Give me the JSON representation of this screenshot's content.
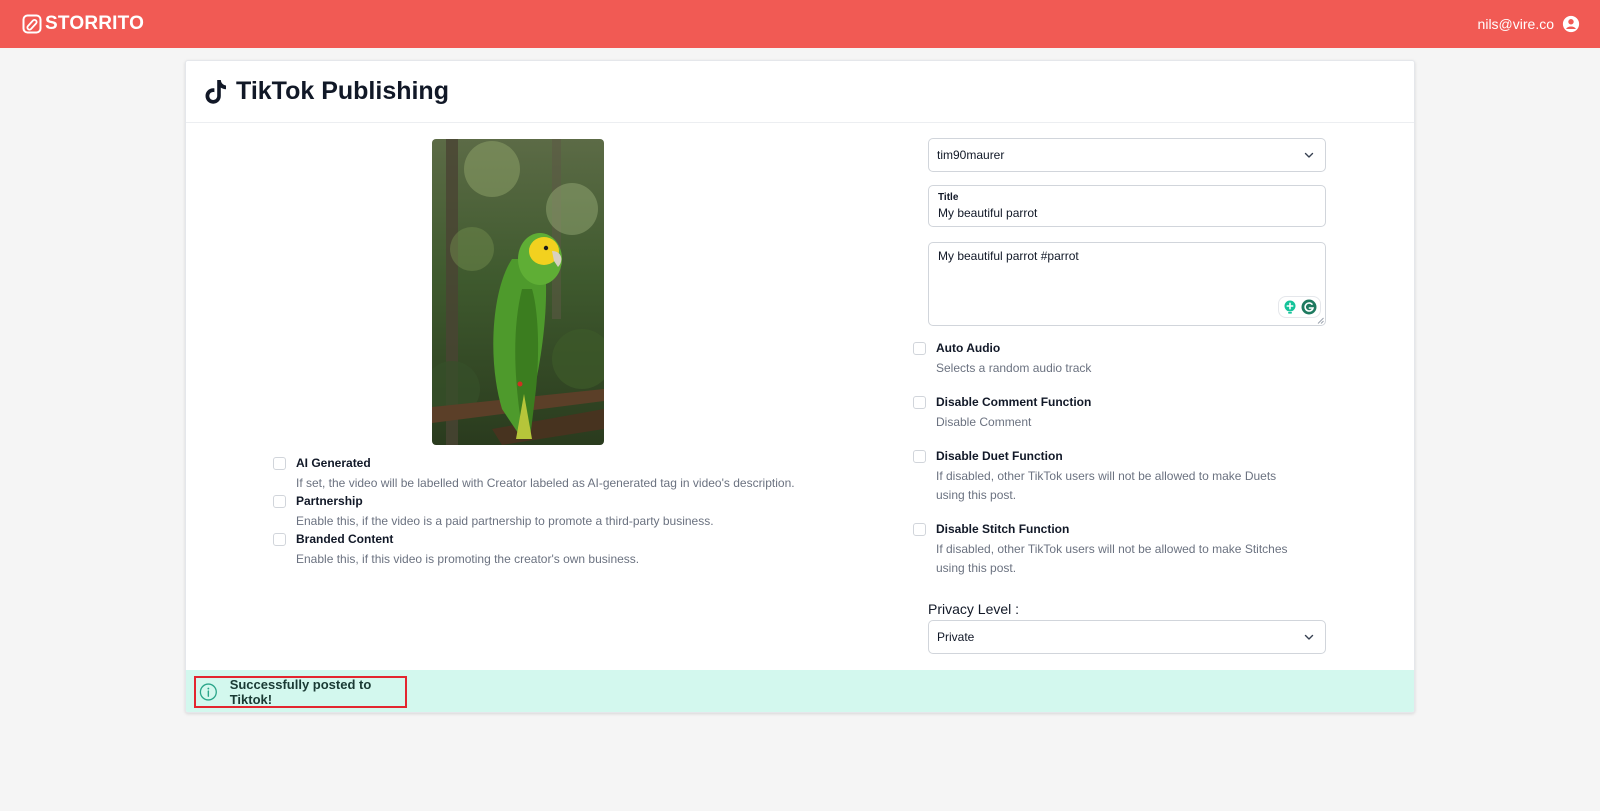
{
  "app": {
    "brand_name": "STORRITO",
    "user_email": "nils@vire.co"
  },
  "page": {
    "title": "TikTok Publishing"
  },
  "left_options": [
    {
      "title": "AI Generated",
      "description": "If set, the video will be labelled with Creator labeled as AI-generated tag in video's description.",
      "checked": false
    },
    {
      "title": "Partnership",
      "description": "Enable this, if the video is a paid partnership to promote a third-party business.",
      "checked": false
    },
    {
      "title": "Branded Content",
      "description": "Enable this, if this video is promoting the creator's own business.",
      "checked": false
    }
  ],
  "form": {
    "account_selected": "tim90maurer",
    "title_label": "Title",
    "title_value": "My beautiful parrot",
    "description_value": "My beautiful parrot #parrot",
    "privacy_label": "Privacy Level :",
    "privacy_selected": "Private"
  },
  "right_options": [
    {
      "title": "Auto Audio",
      "description": "Selects a random audio track",
      "checked": false
    },
    {
      "title": "Disable Comment Function",
      "description": "Disable Comment",
      "checked": false
    },
    {
      "title": "Disable Duet Function",
      "description": "If disabled, other TikTok users will not be allowed to make Duets using this post.",
      "checked": false
    },
    {
      "title": "Disable Stitch Function",
      "description": "If disabled, other TikTok users will not be allowed to make Stitches using this post.",
      "checked": false
    }
  ],
  "alert": {
    "message": "Successfully posted to Tiktok!"
  },
  "colors": {
    "topbar": "#f15a54",
    "alert_bg": "#d3f8ee",
    "alert_border": "#e3262f",
    "grammarly": "#15c39a"
  },
  "icons": [
    "storrito-logo-icon",
    "user-account-icon",
    "tiktok-icon",
    "chevron-down-icon",
    "grammarly-suggest-icon",
    "grammarly-icon",
    "info-icon"
  ]
}
